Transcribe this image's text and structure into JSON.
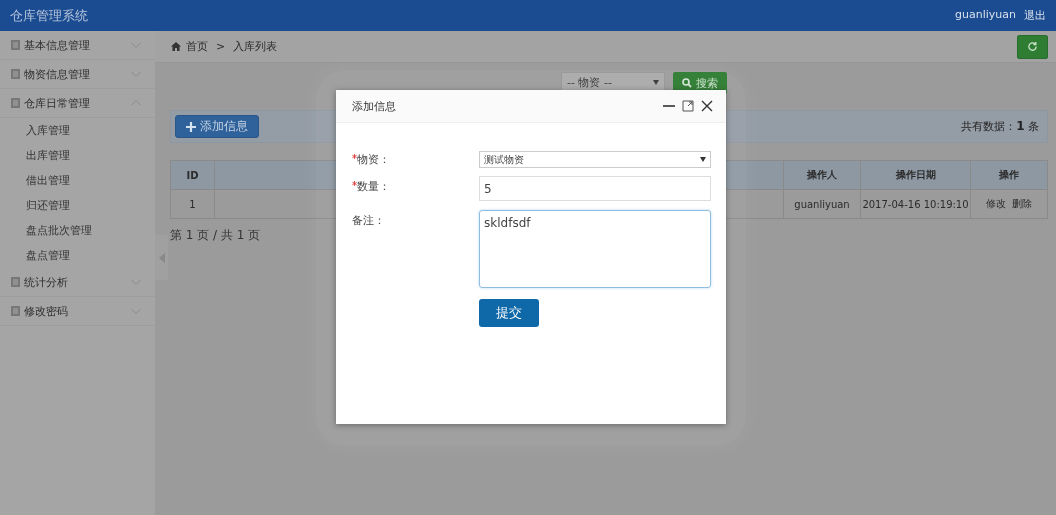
{
  "header": {
    "title": "仓库管理系统",
    "user": "guanliyuan",
    "logout": "退出"
  },
  "sidebar": {
    "items": [
      {
        "label": "基本信息管理",
        "expanded": false
      },
      {
        "label": "物资信息管理",
        "expanded": false
      },
      {
        "label": "仓库日常管理",
        "expanded": true,
        "children": [
          {
            "label": "入库管理"
          },
          {
            "label": "出库管理"
          },
          {
            "label": "借出管理"
          },
          {
            "label": "归还管理"
          },
          {
            "label": "盘点批次管理"
          },
          {
            "label": "盘点管理"
          }
        ]
      },
      {
        "label": "统计分析",
        "expanded": false
      },
      {
        "label": "修改密码",
        "expanded": false
      }
    ]
  },
  "breadcrumb": [
    "首页",
    ">",
    "入库列表"
  ],
  "filter": {
    "select": "-- 物资 --",
    "search": "搜索"
  },
  "toolbar": {
    "add": "添加信息",
    "total_label": "共有数据：",
    "total": "1",
    "total_unit": "条"
  },
  "table": {
    "columns": [
      "ID",
      "",
      "操作人",
      "操作日期",
      "操作"
    ],
    "rows": [
      {
        "cells": [
          "1",
          "",
          "guanliyuan",
          "2017-04-16 10:19:10"
        ],
        "actions": [
          "修改",
          "删除"
        ]
      }
    ]
  },
  "pagination": "第 1 页 / 共 1 页",
  "dialog": {
    "title": "添加信息",
    "fields": [
      {
        "kind": "select",
        "label": "物资：",
        "required": true,
        "value": "测试物资"
      },
      {
        "kind": "input",
        "label": "数量：",
        "required": true,
        "value": "5"
      },
      {
        "kind": "textarea",
        "label": "备注：",
        "required": false,
        "value": "skldfsdf"
      }
    ],
    "submit": "提交"
  }
}
